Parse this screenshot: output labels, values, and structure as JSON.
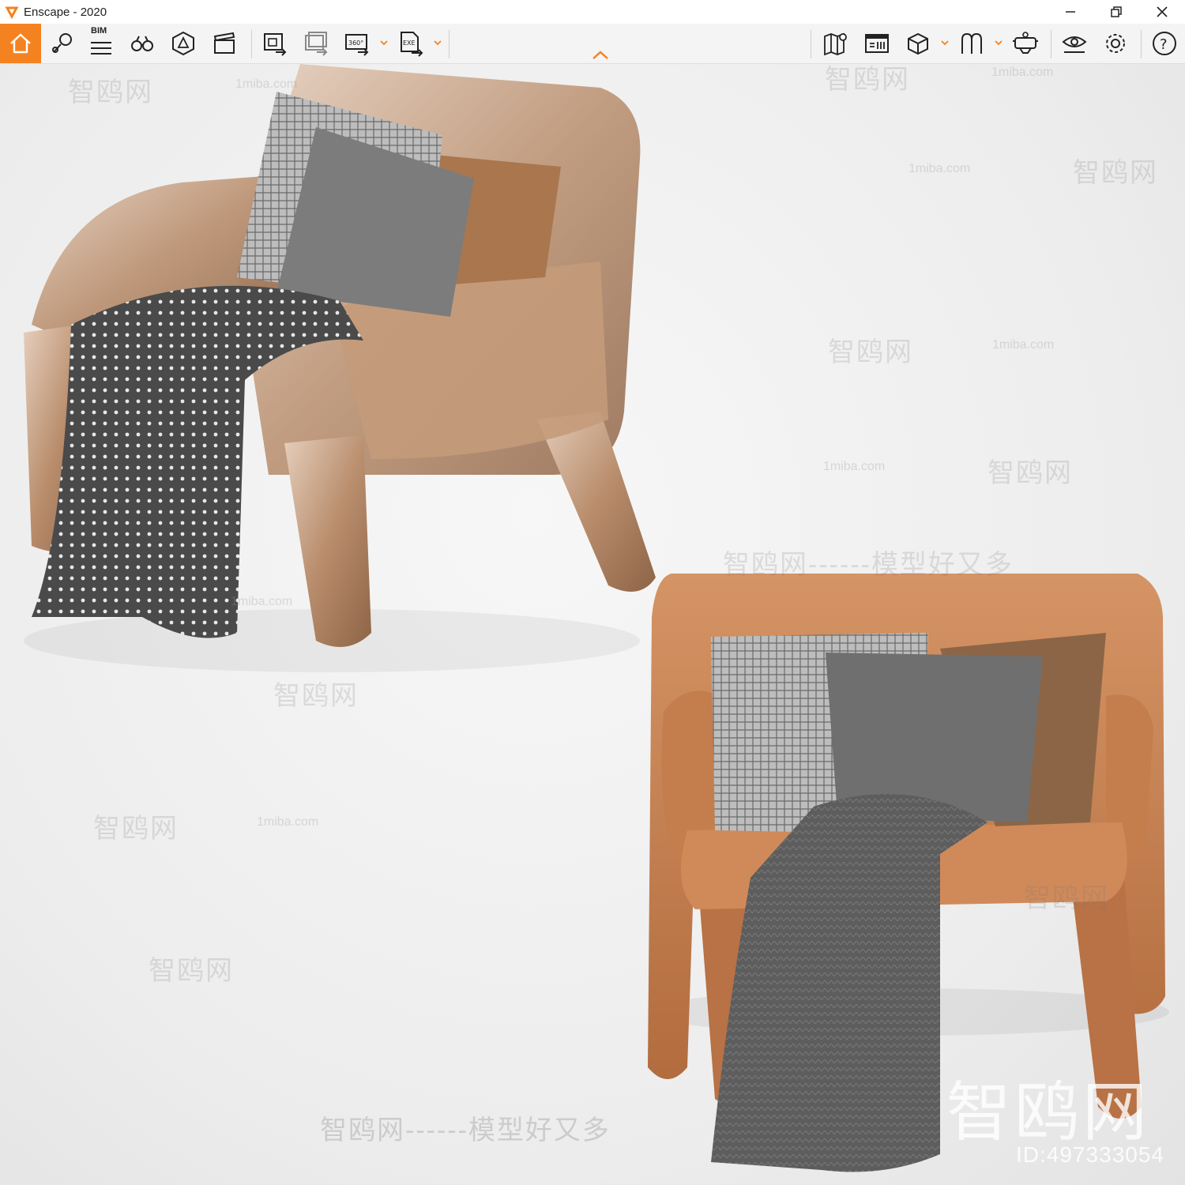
{
  "window": {
    "title": "Enscape - 2020",
    "controls": [
      "minimize",
      "restore",
      "close"
    ]
  },
  "toolbar": {
    "accent_color": "#f58220",
    "bim_label": "BIM",
    "left_tools": [
      {
        "name": "home-icon"
      },
      {
        "name": "location-pin-icon"
      },
      {
        "name": "bim-menu-icon"
      },
      {
        "name": "binoculars-icon"
      },
      {
        "name": "asset-library-icon"
      },
      {
        "name": "video-clapper-icon"
      },
      {
        "name": "screenshot-export-icon"
      },
      {
        "name": "batch-render-icon"
      },
      {
        "name": "panorama-360-icon"
      },
      {
        "name": "exe-export-icon"
      }
    ],
    "right_tools": [
      {
        "name": "map-icon"
      },
      {
        "name": "views-icon"
      },
      {
        "name": "section-box-icon"
      },
      {
        "name": "walkthrough-icon"
      },
      {
        "name": "vr-headset-icon"
      },
      {
        "name": "visual-settings-icon"
      },
      {
        "name": "settings-gear-icon"
      },
      {
        "name": "help-icon"
      }
    ]
  },
  "viewport": {
    "watermarks": {
      "site": "1miba.com",
      "brand": "智鸥网",
      "slogan": "智鸥网------模型好又多",
      "logo_text": "智鸥网",
      "id_text": "ID:497333054"
    },
    "scene": {
      "chair_1_color": "#b98e6d",
      "chair_2_color": "#c98555",
      "throw_color": "#5a5a5a"
    }
  }
}
